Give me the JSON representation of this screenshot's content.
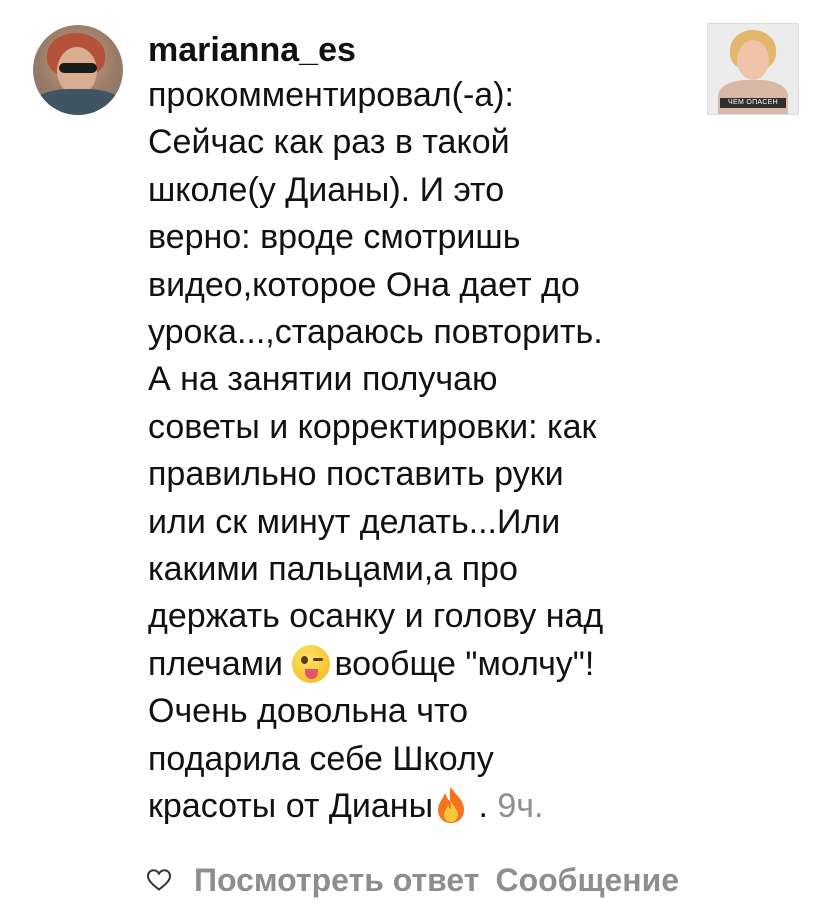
{
  "notification": {
    "username": "marianna_es",
    "lines": [
      "прокомментировал(-а):",
      "Сейчас как раз в такой",
      "школе(у Дианы). И это",
      "верно: вроде смотришь",
      "видео,которое Она дает до",
      "урока...,стараюсь повторить.",
      "А на занятии получаю",
      "советы и корректировки: как",
      "правильно поставить руки",
      "или ск минут делать...Или",
      "какими пальцами,а про",
      "держать осанку и голову над"
    ],
    "line13_before_emoji": "плечами ",
    "line13_after_emoji": "вообще \"молчу\"!",
    "line14": "Очень довольна что",
    "line15": "подарила себе Школу",
    "line16_before_emoji": "красоты от Дианы",
    "line16_after_emoji": " . ",
    "time": "9ч.",
    "thumbnail_caption": "ЧЕМ ОПАСЕН"
  },
  "actions": {
    "reply_label": "Посмотреть ответ",
    "message_label": "Сообщение"
  },
  "icons": {
    "like": "heart-outline-icon",
    "emoji1": "winking-face-with-tongue-emoji",
    "emoji2": "fire-emoji"
  },
  "colors": {
    "text": "#111111",
    "muted": "#8e8e8e",
    "background": "#ffffff"
  }
}
